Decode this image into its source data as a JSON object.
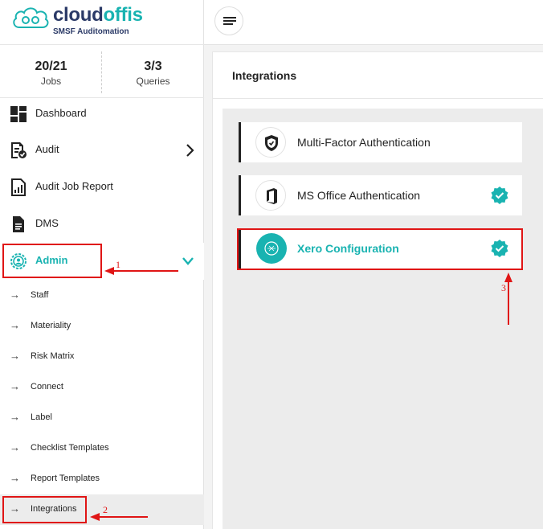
{
  "brand": {
    "logo_part1": "cloud",
    "logo_part2": "offis",
    "tagline": "SMSF Auditomation",
    "colors": {
      "teal": "#19b3b1",
      "navy": "#2b3a67",
      "annotation_red": "#e01515"
    }
  },
  "stats": {
    "jobs_value": "20/21",
    "jobs_label": "Jobs",
    "queries_value": "3/3",
    "queries_label": "Queries"
  },
  "sidebar": {
    "items": [
      {
        "label": "Dashboard",
        "icon": "dashboard-icon"
      },
      {
        "label": "Audit",
        "icon": "audit-icon"
      },
      {
        "label": "Audit Job Report",
        "icon": "report-icon"
      },
      {
        "label": "DMS",
        "icon": "document-icon"
      },
      {
        "label": "Admin",
        "icon": "admin-gear-icon"
      }
    ],
    "admin_sub": [
      {
        "label": "Staff"
      },
      {
        "label": "Materiality"
      },
      {
        "label": "Risk Matrix"
      },
      {
        "label": "Connect"
      },
      {
        "label": "Label"
      },
      {
        "label": "Checklist Templates"
      },
      {
        "label": "Report Templates"
      },
      {
        "label": "Integrations"
      }
    ]
  },
  "main": {
    "title": "Integrations",
    "cards": [
      {
        "label": "Multi-Factor Authentication",
        "icon": "shield-icon",
        "verified": false
      },
      {
        "label": "MS Office Authentication",
        "icon": "office-icon",
        "verified": true
      },
      {
        "label": "Xero Configuration",
        "icon": "xero-icon",
        "verified": true
      }
    ]
  },
  "annotations": {
    "num1": "1",
    "num2": "2",
    "num3": "3"
  }
}
